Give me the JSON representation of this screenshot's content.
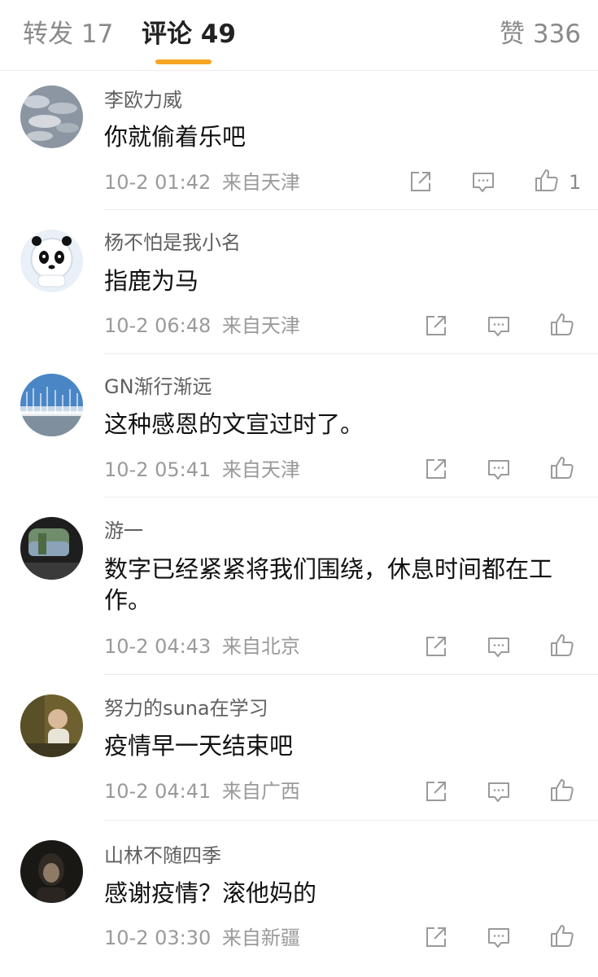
{
  "tabs": {
    "repost": "转发 17",
    "comments": "评论 49",
    "likes": "赞 336"
  },
  "comments": [
    {
      "user": "李欧力威",
      "text": "你就偷着乐吧",
      "time": "10-2 01:42",
      "source": "来自天津",
      "likes": "1"
    },
    {
      "user": "杨不怕是我小名",
      "text": "指鹿为马",
      "time": "10-2 06:48",
      "source": "来自天津",
      "likes": ""
    },
    {
      "user": "GN渐行渐远",
      "text": "这种感恩的文宣过时了。",
      "time": "10-2 05:41",
      "source": "来自天津",
      "likes": ""
    },
    {
      "user": "游一",
      "text": "数字已经紧紧将我们围绕，休息时间都在工作。",
      "time": "10-2 04:43",
      "source": "来自北京",
      "likes": ""
    },
    {
      "user": "努力的suna在学习",
      "text": "疫情早一天结束吧",
      "time": "10-2 04:41",
      "source": "来自广西",
      "likes": ""
    },
    {
      "user": "山林不随四季",
      "text": "感谢疫情？滚他妈的",
      "time": "10-2 03:30",
      "source": "来自新疆",
      "likes": ""
    }
  ],
  "colors": {
    "accent": "#f5a623",
    "icon": "#9a9a9a",
    "divider": "#ececec"
  },
  "icons": {
    "repost": "repost-icon",
    "comment": "comment-icon",
    "like": "thumbs-up-icon"
  }
}
